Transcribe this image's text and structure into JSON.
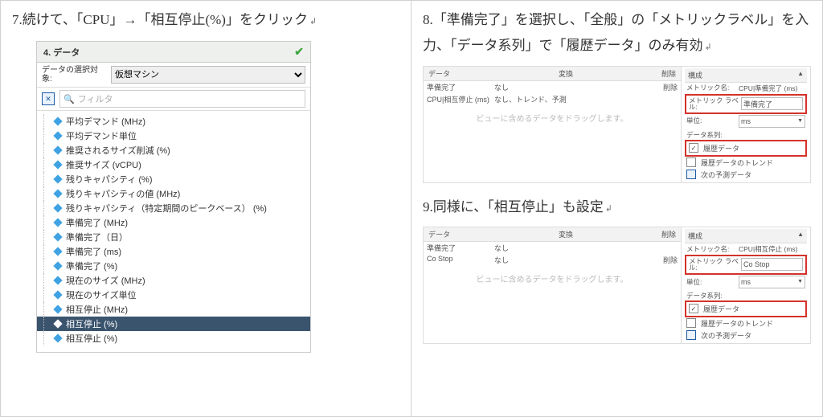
{
  "left": {
    "instruction": "7.続けて、「CPU」→「相互停止(%)」をクリック",
    "panel_title": "4. データ",
    "sel_label": "データの選択対象:",
    "sel_value": "仮想マシン",
    "filter_placeholder": "フィルタ",
    "tree": [
      "平均デマンド (MHz)",
      "平均デマンド単位",
      "推奨されるサイズ削減 (%)",
      "推奨サイズ (vCPU)",
      "残りキャパシティ (%)",
      "残りキャパシティの値 (MHz)",
      "残りキャパシティ（特定期間のピークベース） (%)",
      "準備完了 (MHz)",
      "準備完了（日）",
      "準備完了 (ms)",
      "準備完了 (%)",
      "現在のサイズ (MHz)",
      "現在のサイズ単位",
      "相互停止 (MHz)",
      "相互停止 (%)",
      "相互停止 (%)"
    ],
    "selected_index": 14
  },
  "right": {
    "instr8": "8.「準備完了」を選択し、「全般」の「メトリックラベル」を入力、「データ系列」で「履歴データ」のみ有効",
    "instr9": "9.同様に、「相互停止」も設定",
    "headers": {
      "data": "データ",
      "conv": "変換",
      "del": "削除",
      "cfg": "構成"
    },
    "metric_name_label": "メトリック名:",
    "metric_label_label": "メトリック ラベル:",
    "unit_label": "単位:",
    "series_label": "データ系列:",
    "hist": "履歴データ",
    "trend": "履歴データのトレンド",
    "forecast": "次の予測データ",
    "drag_hint": "ビューに含めるデータをドラッグします。",
    "panel8": {
      "rows": [
        {
          "c1": "準備完了",
          "c2": "なし",
          "c3": "削除"
        },
        {
          "c1": "CPU|相互停止 (ms)",
          "c2": "なし、トレンド、予測",
          "c3": ""
        }
      ],
      "metric_name": "CPU|準備完了 (ms)",
      "metric_label_value": "準備完了",
      "unit": "ms"
    },
    "panel9": {
      "rows": [
        {
          "c1": "準備完了",
          "c2": "なし",
          "c3": ""
        },
        {
          "c1": "Co Stop",
          "c2": "なし",
          "c3": "削除"
        }
      ],
      "metric_name": "CPU|相互停止 (ms)",
      "metric_label_value": "Co Stop",
      "unit": "ms"
    }
  }
}
